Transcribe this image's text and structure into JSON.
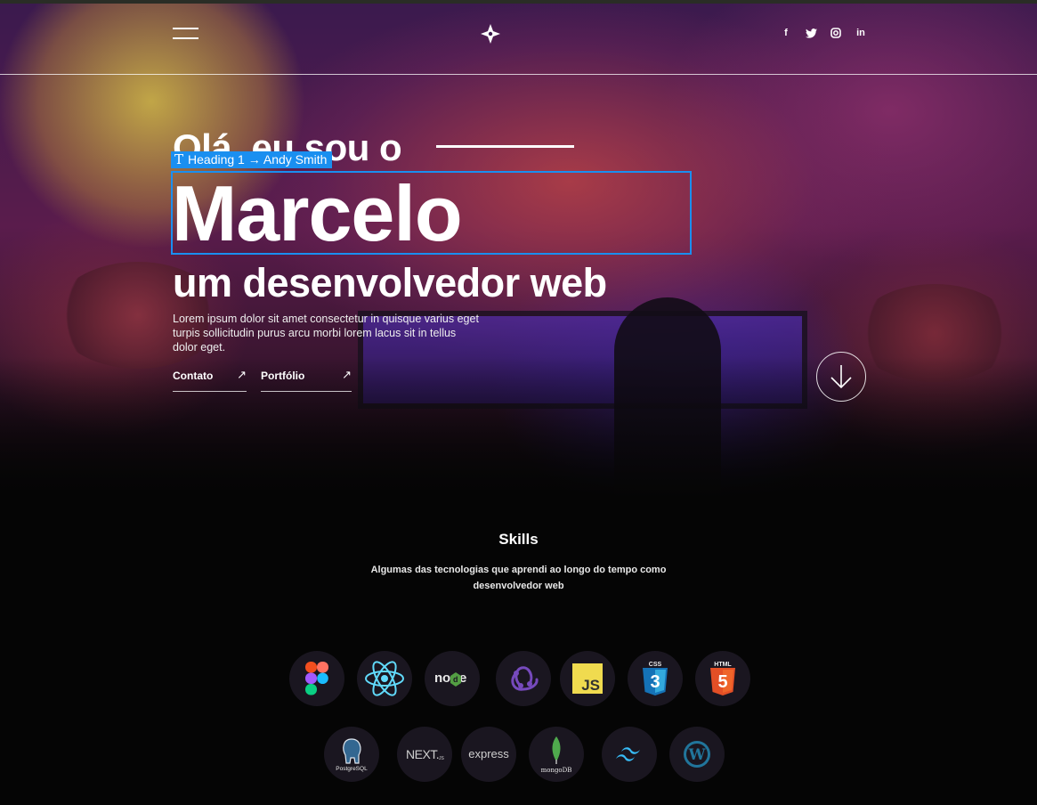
{
  "nav": {
    "menu_icon": "hamburger-menu-icon",
    "logo_icon": "star-logo-icon",
    "social_icons": [
      "facebook-icon",
      "twitter-icon",
      "instagram-icon",
      "linkedin-icon"
    ],
    "facebook_glyph": "f",
    "linkedin_glyph": "in"
  },
  "hero": {
    "greeting": "Olá, eu sou o",
    "name": "Marcelo",
    "role": "um desenvolvedor web",
    "description": "Lorem ipsum dolor sit amet consectetur in quisque varius eget turpis sollicitudin purus arcu morbi lorem lacus sit in tellus dolor eget.",
    "buttons": [
      {
        "label": "Contato",
        "icon": "arrow-up-right-icon"
      },
      {
        "label": "Portfólio",
        "icon": "arrow-up-right-icon"
      }
    ],
    "scroll_icon": "arrow-down-circle-icon"
  },
  "editor_overlay": {
    "tag_label": "Heading 1 → Andy Smith",
    "tag_color": "#1a8ff0"
  },
  "skills": {
    "title": "Skills",
    "subtitle": "Algumas das tecnologias que aprendi ao longo do tempo como desenvolvedor web",
    "icons_row1": [
      "figma-icon",
      "react-icon",
      "nodejs-icon",
      "redux-icon",
      "javascript-icon",
      "css3-icon",
      "html5-icon"
    ],
    "icons_row2": [
      "postgresql-icon",
      "nextjs-icon",
      "express-icon",
      "mongodb-icon",
      "tailwind-icon",
      "wordpress-icon"
    ],
    "labels": {
      "js": "JS",
      "css": "CSS",
      "css_num": "3",
      "html": "HTML",
      "html_num": "5",
      "postgres": "PostgreSQL",
      "next": "NEXT.",
      "next_sub": "JS",
      "express": "express",
      "mongo": "mongoDB",
      "wordpress": "W"
    }
  },
  "colors": {
    "background": "#050505",
    "accent": "#1a8ff0",
    "chip_bg": "#1a1620"
  }
}
